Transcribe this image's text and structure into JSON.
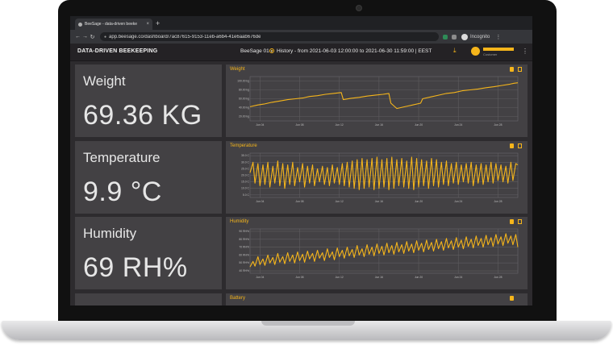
{
  "browser": {
    "tab_title": "BeeSage - data-driven beeke",
    "tab_close": "×",
    "new_tab": "+",
    "url": "app.beesage.co/dashboard/7ac87615-9153-11eb-a6b4-41e6aab676de",
    "incognito_label": "Incognito",
    "nav": {
      "back": "←",
      "forward": "→",
      "reload": "↻"
    },
    "menu": "⋮"
  },
  "header": {
    "brand": "DATA-DRIVEN BEEKEEPING",
    "hive_name": "BeeSage 01",
    "hive_caret": "▾",
    "history": "History - from 2021-06-03 12:00:00 to 2021-06-30 11:59:00 | EEST",
    "user_initial": "●",
    "user_sub": "Customer",
    "menu": "⋮",
    "download": "⤓"
  },
  "colors": {
    "accent": "#f5b51b",
    "panel_bg": "#434144",
    "page_bg": "#2d2b2e"
  },
  "cards": [
    {
      "title": "Weight",
      "value": "69.36 KG"
    },
    {
      "title": "Temperature",
      "value": "9.9 °C"
    },
    {
      "title": "Humidity",
      "value": "69 RH%"
    }
  ],
  "chart_data": [
    {
      "type": "line",
      "title": "Weight",
      "y_ticks": [
        "100.00 kg",
        "80.00 kg",
        "60.00 kg",
        "40.00 kg",
        "20.00 kg"
      ],
      "ylim": [
        10,
        110
      ],
      "x_ticks": [
        "Jun 04",
        "Jun 08",
        "Jun 12",
        "Jun 16",
        "Jun 20",
        "Jun 24",
        "Jun 28"
      ],
      "xlim": [
        3,
        30
      ],
      "series": [
        {
          "x": [
            3,
            3.8,
            4.4,
            5.2,
            6,
            6.8,
            7.6,
            8.4,
            9,
            9.8,
            10.6,
            11.4,
            12.2,
            12.4,
            13.2,
            14,
            14.8,
            15.6,
            16.4,
            17,
            17.2,
            17.8,
            18.6,
            19.4,
            20.2,
            20.4,
            21.2,
            22,
            22.8,
            23.6,
            24.4,
            25.2,
            26,
            26.8,
            27.6,
            28.4,
            29.2,
            29.6,
            30
          ],
          "y": [
            42,
            46,
            48,
            52,
            55,
            58,
            60,
            62,
            65,
            67,
            70,
            72,
            74,
            58,
            61,
            63,
            66,
            68,
            70,
            72,
            50,
            38,
            42,
            46,
            50,
            60,
            64,
            68,
            72,
            74,
            78,
            80,
            82,
            85,
            87,
            90,
            93,
            95,
            96
          ]
        }
      ]
    },
    {
      "type": "line",
      "title": "Temperature",
      "y_ticks": [
        "35.0 C",
        "30.0 C",
        "25.0 C",
        "20.0 C",
        "15.0 C",
        "10.0 C",
        "5.0 C"
      ],
      "ylim": [
        3,
        37
      ],
      "x_ticks": [
        "Jun 04",
        "Jun 08",
        "Jun 12",
        "Jun 16",
        "Jun 20",
        "Jun 24",
        "Jun 28"
      ],
      "xlim": [
        3,
        30
      ],
      "series": [
        {
          "x": [
            3,
            3.3,
            3.5,
            3.8,
            4,
            4.3,
            4.5,
            4.8,
            5,
            5.3,
            5.5,
            5.8,
            6,
            6.3,
            6.5,
            6.8,
            7,
            7.3,
            7.5,
            7.8,
            8,
            8.3,
            8.5,
            8.8,
            9,
            9.3,
            9.5,
            9.8,
            10,
            10.3,
            10.5,
            10.8,
            11,
            11.3,
            11.5,
            11.8,
            12,
            12.3,
            12.5,
            12.8,
            13,
            13.3,
            13.5,
            13.8,
            14,
            14.3,
            14.5,
            14.8,
            15,
            15.3,
            15.5,
            15.8,
            16,
            16.3,
            16.5,
            16.8,
            17,
            17.3,
            17.5,
            17.8,
            18,
            18.3,
            18.5,
            18.8,
            19,
            19.3,
            19.5,
            19.8,
            20,
            20.3,
            20.5,
            20.8,
            21,
            21.3,
            21.5,
            21.8,
            22,
            22.3,
            22.5,
            22.8,
            23,
            23.3,
            23.5,
            23.8,
            24,
            24.3,
            24.5,
            24.8,
            25,
            25.3,
            25.5,
            25.8,
            26,
            26.3,
            26.5,
            26.8,
            27,
            27.3,
            27.5,
            27.8,
            28,
            28.3,
            28.5,
            28.8,
            29,
            29.3,
            29.5,
            29.8,
            30
          ],
          "y": [
            22,
            30,
            14,
            29,
            12,
            28,
            13,
            30,
            11,
            27,
            14,
            31,
            12,
            29,
            10,
            28,
            13,
            30,
            12,
            26,
            15,
            29,
            11,
            27,
            14,
            28,
            12,
            25,
            15,
            27,
            13,
            26,
            12,
            28,
            14,
            26,
            13,
            29,
            12,
            30,
            11,
            31,
            10,
            32,
            9,
            33,
            10,
            32,
            11,
            33,
            9,
            34,
            10,
            32,
            11,
            33,
            9,
            34,
            10,
            32,
            12,
            33,
            11,
            31,
            10,
            34,
            9,
            33,
            11,
            32,
            12,
            31,
            10,
            33,
            12,
            32,
            11,
            30,
            13,
            31,
            12,
            29,
            14,
            30,
            13,
            28,
            15,
            29,
            14,
            30,
            12,
            28,
            14,
            29,
            13,
            28,
            15,
            30,
            14,
            29,
            16,
            28,
            15,
            27,
            14,
            30,
            16,
            29,
            28
          ]
        }
      ]
    },
    {
      "type": "line",
      "title": "Humidity",
      "y_ticks": [
        "90 RH%",
        "80 RH%",
        "70 RH%",
        "60 RH%",
        "50 RH%",
        "40 RH%"
      ],
      "ylim": [
        37,
        93
      ],
      "x_ticks": [
        "Jun 04",
        "Jun 08",
        "Jun 12",
        "Jun 16",
        "Jun 20",
        "Jun 24",
        "Jun 28"
      ],
      "xlim": [
        3,
        30
      ],
      "series": [
        {
          "x": [
            3,
            3.3,
            3.5,
            3.8,
            4,
            4.3,
            4.5,
            4.8,
            5,
            5.3,
            5.5,
            5.8,
            6,
            6.3,
            6.5,
            6.8,
            7,
            7.3,
            7.5,
            7.8,
            8,
            8.3,
            8.5,
            8.8,
            9,
            9.3,
            9.5,
            9.8,
            10,
            10.3,
            10.5,
            10.8,
            11,
            11.3,
            11.5,
            11.8,
            12,
            12.3,
            12.5,
            12.8,
            13,
            13.3,
            13.5,
            13.8,
            14,
            14.3,
            14.5,
            14.8,
            15,
            15.3,
            15.5,
            15.8,
            16,
            16.3,
            16.5,
            16.8,
            17,
            17.3,
            17.5,
            17.8,
            18,
            18.3,
            18.5,
            18.8,
            19,
            19.3,
            19.5,
            19.8,
            20,
            20.3,
            20.5,
            20.8,
            21,
            21.3,
            21.5,
            21.8,
            22,
            22.3,
            22.5,
            22.8,
            23,
            23.3,
            23.5,
            23.8,
            24,
            24.3,
            24.5,
            24.8,
            25,
            25.3,
            25.5,
            25.8,
            26,
            26.3,
            26.5,
            26.8,
            27,
            27.3,
            27.5,
            27.8,
            28,
            28.3,
            28.5,
            28.8,
            29,
            29.3,
            29.5,
            29.8,
            30
          ],
          "y": [
            45,
            52,
            46,
            58,
            48,
            55,
            47,
            60,
            50,
            57,
            48,
            62,
            51,
            58,
            49,
            63,
            52,
            60,
            50,
            64,
            53,
            61,
            51,
            65,
            55,
            62,
            52,
            66,
            56,
            63,
            53,
            68,
            57,
            64,
            54,
            69,
            58,
            66,
            56,
            70,
            59,
            67,
            57,
            72,
            60,
            68,
            58,
            73,
            61,
            70,
            59,
            74,
            62,
            71,
            60,
            75,
            63,
            72,
            61,
            76,
            64,
            73,
            62,
            77,
            65,
            74,
            63,
            78,
            66,
            75,
            64,
            79,
            67,
            76,
            65,
            80,
            68,
            77,
            66,
            81,
            69,
            78,
            67,
            82,
            70,
            79,
            68,
            83,
            71,
            80,
            69,
            84,
            72,
            81,
            70,
            85,
            73,
            82,
            71,
            86,
            74,
            83,
            72,
            87,
            75,
            84,
            73,
            86,
            70
          ]
        }
      ]
    }
  ],
  "battery_panel": {
    "title": "Battery"
  }
}
